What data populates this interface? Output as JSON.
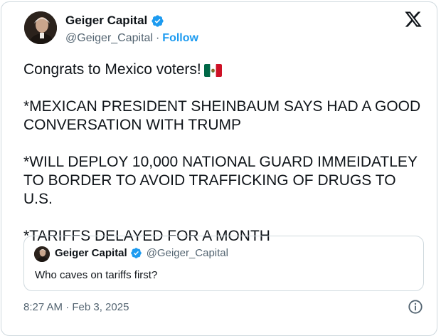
{
  "author": {
    "display_name": "Geiger Capital",
    "handle": "@Geiger_Capital",
    "separator": "·",
    "follow_label": "Follow"
  },
  "tweet": {
    "text": "Congrats to Mexico voters!",
    "body": "*MEXICAN PRESIDENT SHEINBAUM SAYS HAD A GOOD CONVERSATION WITH TRUMP\n\n*WILL DEPLOY 10,000 NATIONAL GUARD IMMEIDATLEY TO BORDER TO AVOID TRAFFICKING OF DRUGS TO U.S.\n\n*TARIFFS DELAYED FOR A MONTH",
    "timestamp": "8:27 AM · Feb 3, 2025"
  },
  "quoted_tweet": {
    "display_name": "Geiger Capital",
    "handle": "@Geiger_Capital",
    "text": "Who caves on tariffs first?"
  },
  "icons": {
    "verified": "verified-badge-icon",
    "platform": "x-logo-icon",
    "flag": "mexico-flag-icon",
    "info": "info-icon"
  },
  "colors": {
    "accent": "#1d9bf0",
    "secondary_text": "#536471",
    "border": "#cfd9de",
    "flag_green": "#006847",
    "flag_red": "#ce1126"
  }
}
